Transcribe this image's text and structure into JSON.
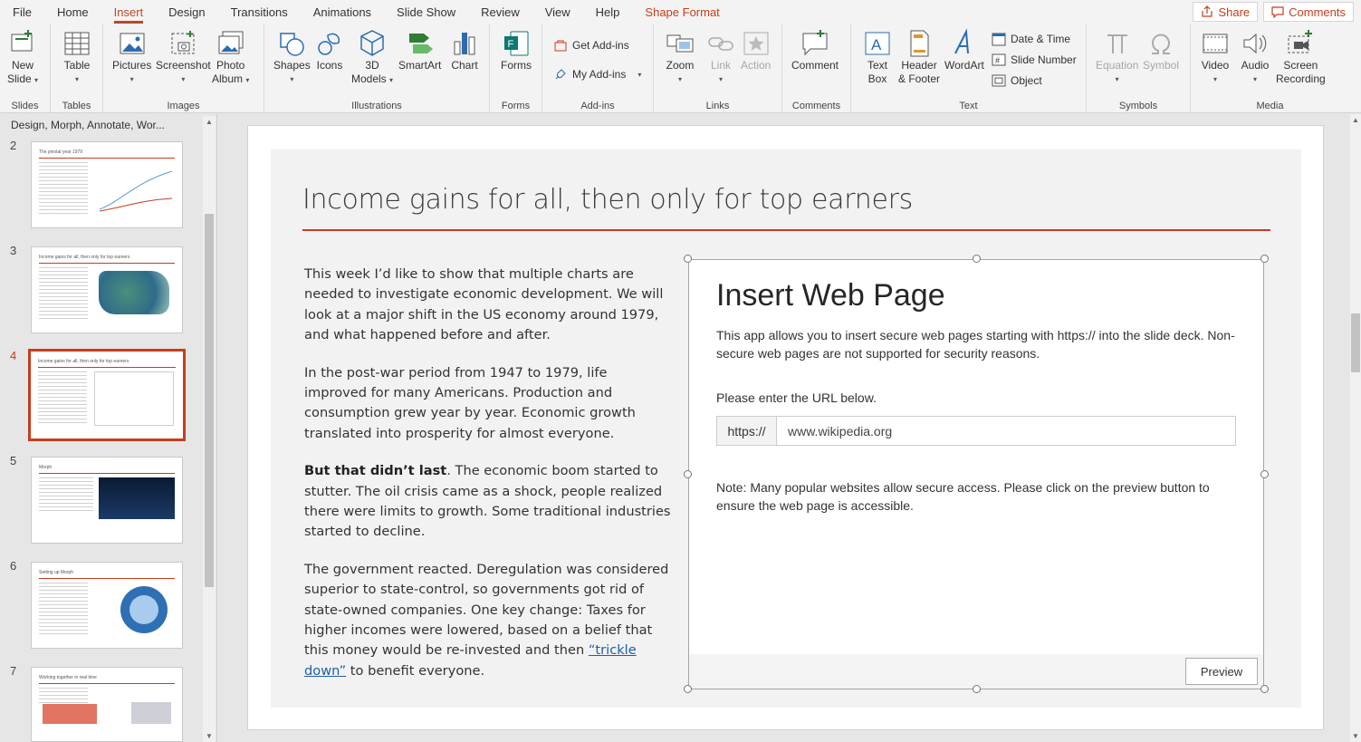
{
  "menu": {
    "items": [
      "File",
      "Home",
      "Insert",
      "Design",
      "Transitions",
      "Animations",
      "Slide Show",
      "Review",
      "View",
      "Help"
    ],
    "active": "Insert",
    "contextual": "Shape Format",
    "share": "Share",
    "comments": "Comments"
  },
  "ribbon": {
    "slides": {
      "label": "Slides",
      "new_slide": "New",
      "new_slide2": "Slide"
    },
    "tables": {
      "label": "Tables",
      "table": "Table"
    },
    "images": {
      "label": "Images",
      "pictures": "Pictures",
      "screenshot": "Screenshot",
      "photo_album": "Photo",
      "photo_album2": "Album"
    },
    "illustrations": {
      "label": "Illustrations",
      "shapes": "Shapes",
      "icons": "Icons",
      "models": "3D",
      "models2": "Models",
      "smartart": "SmartArt",
      "chart": "Chart"
    },
    "forms": {
      "label": "Forms",
      "forms": "Forms"
    },
    "addins": {
      "label": "Add-ins",
      "get": "Get Add-ins",
      "my": "My Add-ins"
    },
    "links": {
      "label": "Links",
      "zoom": "Zoom",
      "link": "Link",
      "action": "Action"
    },
    "comments": {
      "label": "Comments",
      "comment": "Comment"
    },
    "text": {
      "label": "Text",
      "textbox": "Text",
      "textbox2": "Box",
      "header": "Header",
      "header2": "& Footer",
      "wordart": "WordArt",
      "date": "Date & Time",
      "slidenum": "Slide Number",
      "object": "Object"
    },
    "symbols": {
      "label": "Symbols",
      "equation": "Equation",
      "symbol": "Symbol"
    },
    "media": {
      "label": "Media",
      "video": "Video",
      "audio": "Audio",
      "screen": "Screen",
      "screen2": "Recording"
    }
  },
  "thumbs": {
    "section": "Design, Morph, Annotate, Wor...",
    "slides": [
      {
        "num": "2",
        "title": "The pivotal year 1979"
      },
      {
        "num": "3",
        "title": "Income gains for all, then only for top earners"
      },
      {
        "num": "4",
        "title": "Income gains for all, then only for top earners"
      },
      {
        "num": "5",
        "title": "Morph"
      },
      {
        "num": "6",
        "title": "Setting up Morph"
      },
      {
        "num": "7",
        "title": "Working together in real time"
      }
    ]
  },
  "slide": {
    "title": "Income gains for all, then only for top earners",
    "p1": "This week I’d like to show that multiple charts are needed to investigate economic development. We will look at a major shift in the US economy around 1979, and what happened before and after.",
    "p2": "In the post-war period from 1947 to 1979, life improved for many Americans. Production and consumption grew year by year. Economic growth translated into prosperity for almost everyone.",
    "p3_bold": "But that didn’t last",
    "p3_rest": ". The economic boom started to stutter. The oil crisis came as a shock, people realized there were limits to growth. Some traditional industries started to decline.",
    "p4_start": "The government reacted. Deregulation was considered superior to state-control, so governments got rid of state-owned companies. One key change: Taxes for higher incomes were lowered, based on a belief that this money would be re-invested and then ",
    "p4_link": "“trickle down”",
    "p4_end": " to benefit everyone."
  },
  "addin": {
    "title": "Insert Web Page",
    "description": "This app allows you to insert secure web pages starting with https:// into the slide deck. Non-secure web pages are not supported for security reasons.",
    "prompt": "Please enter the URL below.",
    "prefix": "https://",
    "url_value": "www.wikipedia.org",
    "note": "Note: Many popular websites allow secure access. Please click on the preview button to ensure the web page is accessible.",
    "preview": "Preview"
  },
  "colors": {
    "accent": "#c43e1c",
    "link": "#1f5fa8"
  }
}
